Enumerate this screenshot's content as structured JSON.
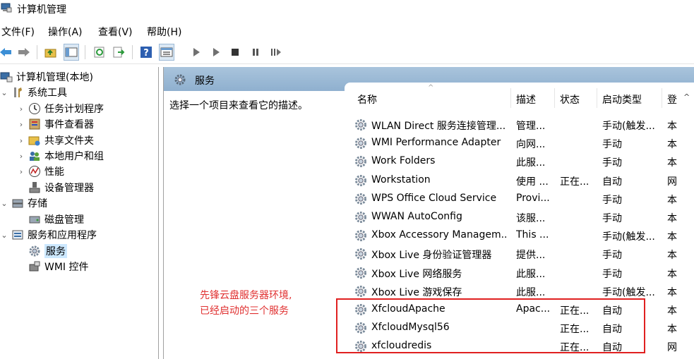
{
  "window": {
    "title": "计算机管理"
  },
  "menu": [
    "文件(F)",
    "操作(A)",
    "查看(V)",
    "帮助(H)"
  ],
  "toolbar_icons": [
    "back-arrow-icon",
    "forward-arrow-icon",
    "up-folder-icon",
    "show-tree-icon",
    "refresh-icon",
    "export-icon",
    "help-icon",
    "properties-icon",
    "play-icon",
    "play-alt-icon",
    "stop-icon",
    "pause-icon",
    "restart-icon"
  ],
  "tree": {
    "root": "计算机管理(本地)",
    "system_tools": "系统工具",
    "task_scheduler": "任务计划程序",
    "event_viewer": "事件查看器",
    "shared_folders": "共享文件夹",
    "local_users": "本地用户和组",
    "performance": "性能",
    "device_manager": "设备管理器",
    "storage": "存储",
    "disk_mgmt": "磁盘管理",
    "services_apps": "服务和应用程序",
    "services": "服务",
    "wmi": "WMI 控件"
  },
  "pane": {
    "title": "服务",
    "description_hint": "选择一个项目来查看它的描述。",
    "note_line1": "先锋云盘服务器环境,",
    "note_line2": "已经启动的三个服务"
  },
  "columns": {
    "name": "名称",
    "desc": "描述",
    "status": "状态",
    "startup": "启动类型",
    "logon": "登"
  },
  "services": [
    {
      "name": "WLAN Direct 服务连接管理...",
      "desc": "管理...",
      "status": "",
      "startup": "手动(触发...",
      "logon": "本"
    },
    {
      "name": "WMI Performance Adapter",
      "desc": "向网...",
      "status": "",
      "startup": "手动",
      "logon": "本"
    },
    {
      "name": "Work Folders",
      "desc": "此服...",
      "status": "",
      "startup": "手动",
      "logon": "本"
    },
    {
      "name": "Workstation",
      "desc": "使用 ...",
      "status": "正在...",
      "startup": "自动",
      "logon": "网"
    },
    {
      "name": "WPS Office Cloud Service",
      "desc": "Provi...",
      "status": "",
      "startup": "手动",
      "logon": "本"
    },
    {
      "name": "WWAN AutoConfig",
      "desc": "该服...",
      "status": "",
      "startup": "手动",
      "logon": "本"
    },
    {
      "name": "Xbox Accessory Managem...",
      "desc": "This ...",
      "status": "",
      "startup": "手动(触发...",
      "logon": "本"
    },
    {
      "name": "Xbox Live 身份验证管理器",
      "desc": "提供...",
      "status": "",
      "startup": "手动",
      "logon": "本"
    },
    {
      "name": "Xbox Live 网络服务",
      "desc": "此服...",
      "status": "",
      "startup": "手动",
      "logon": "本"
    },
    {
      "name": "Xbox Live 游戏保存",
      "desc": "此服...",
      "status": "",
      "startup": "手动(触发...",
      "logon": "本"
    },
    {
      "name": "XfcloudApache",
      "desc": "Apac...",
      "status": "正在...",
      "startup": "自动",
      "logon": "本"
    },
    {
      "name": "XfcloudMysql56",
      "desc": "",
      "status": "正在...",
      "startup": "自动",
      "logon": "本"
    },
    {
      "name": "xfcloudredis",
      "desc": "",
      "status": "正在...",
      "startup": "自动",
      "logon": "网"
    }
  ],
  "colors": {
    "header_blue": "#9cb9d5",
    "highlight_red": "#e02020",
    "note_red": "#e03030",
    "selection": "#cce8ff"
  }
}
